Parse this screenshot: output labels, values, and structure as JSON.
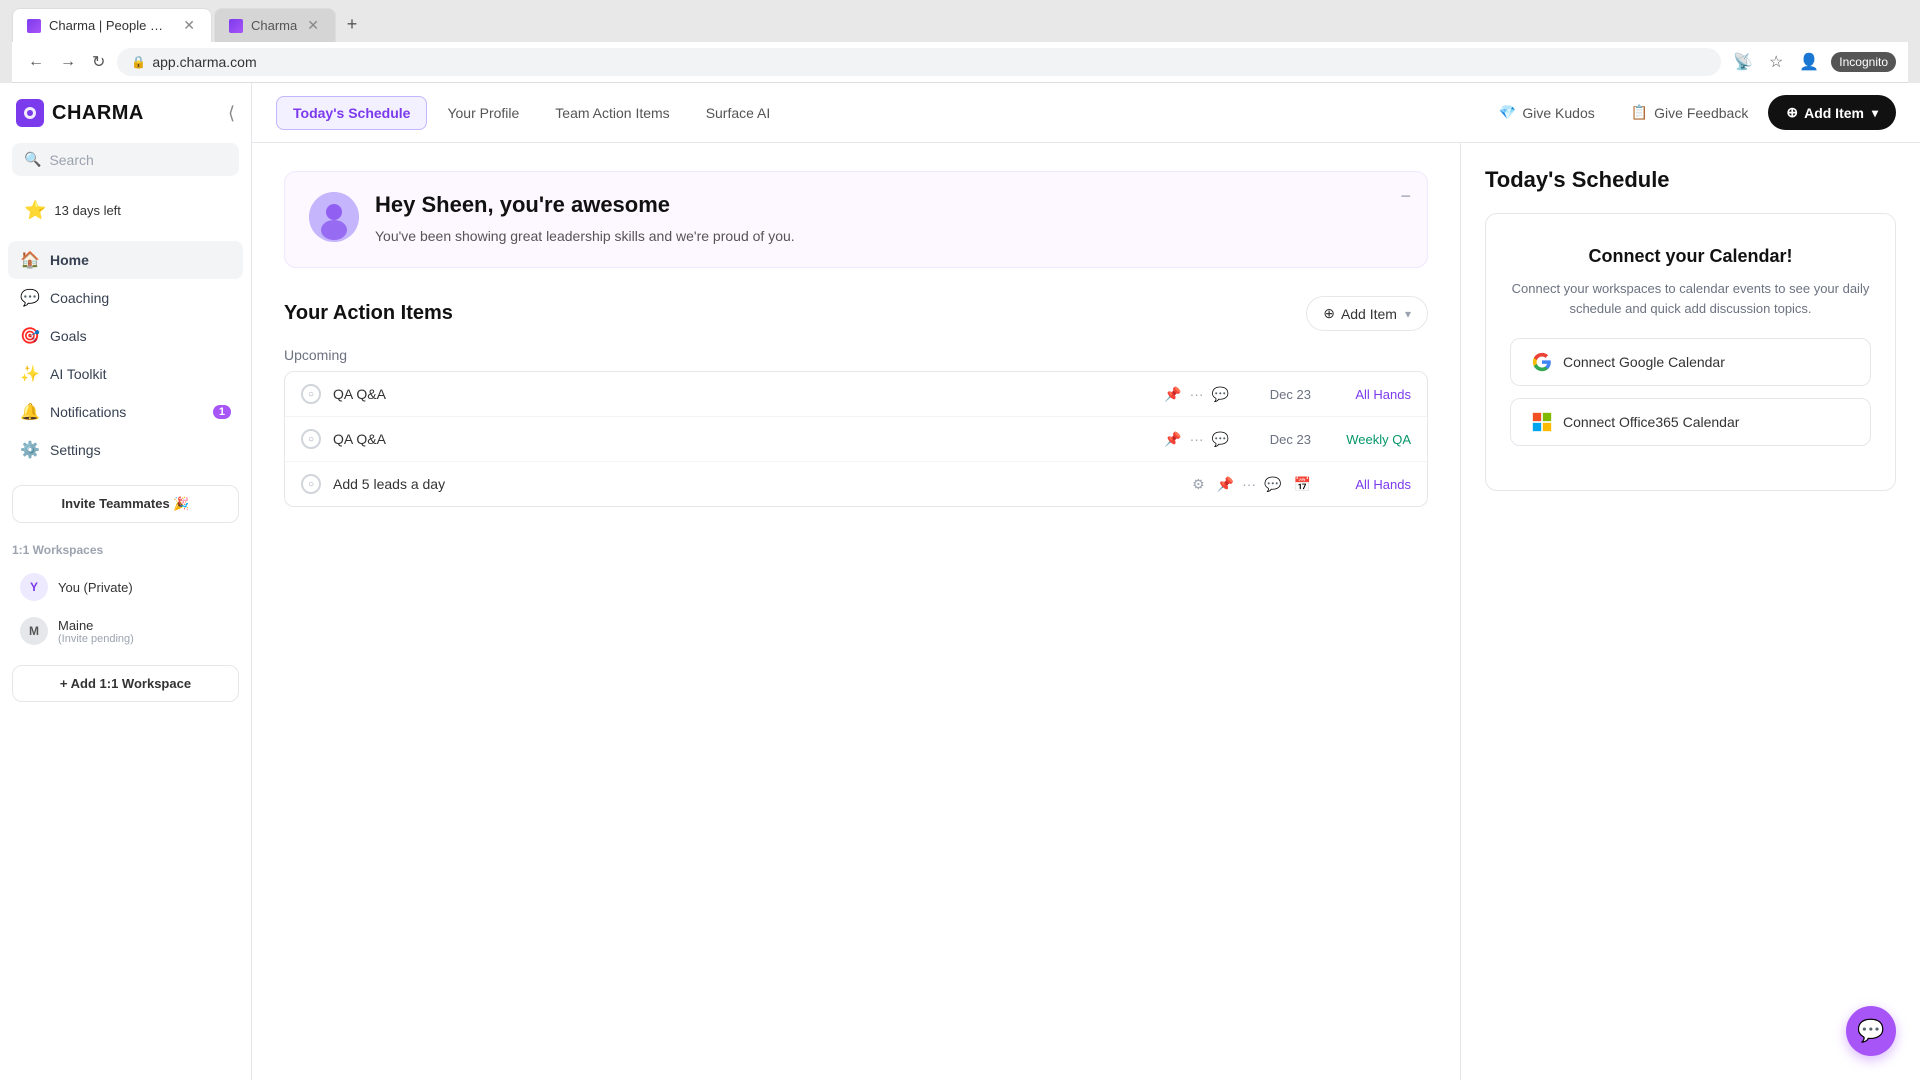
{
  "browser": {
    "tabs": [
      {
        "id": "charma-pm",
        "favicon": "charma",
        "title": "Charma | People Management S...",
        "active": true
      },
      {
        "id": "charma-2",
        "favicon": "charma",
        "title": "Charma",
        "active": false
      }
    ],
    "address": "app.charma.com",
    "incognito_label": "Incognito"
  },
  "sidebar": {
    "logo_text": "CHARMA",
    "search_placeholder": "Search",
    "trial": {
      "icon": "⭐",
      "text": "13 days left"
    },
    "nav_items": [
      {
        "id": "home",
        "icon": "🏠",
        "label": "Home",
        "active": true
      },
      {
        "id": "coaching",
        "icon": "💬",
        "label": "Coaching",
        "active": false
      },
      {
        "id": "goals",
        "icon": "🎯",
        "label": "Goals",
        "active": false
      },
      {
        "id": "ai-toolkit",
        "icon": "✨",
        "label": "AI Toolkit",
        "active": false
      },
      {
        "id": "notifications",
        "icon": "🔔",
        "label": "Notifications",
        "badge": "1",
        "active": false
      },
      {
        "id": "settings",
        "icon": "⚙️",
        "label": "Settings",
        "active": false
      }
    ],
    "invite_btn": "Invite Teammates 🎉",
    "workspaces_label": "1:1 Workspaces",
    "workspaces": [
      {
        "id": "private",
        "name": "You (Private)",
        "sub": "",
        "initial": "Y",
        "color": "purple"
      },
      {
        "id": "maine",
        "name": "Maine",
        "sub": "(Invite pending)",
        "initial": "M",
        "color": "gray"
      }
    ],
    "add_workspace_btn": "+ Add 1:1 Workspace"
  },
  "top_nav": {
    "items": [
      {
        "id": "schedule",
        "label": "Today's Schedule",
        "active": true
      },
      {
        "id": "profile",
        "label": "Your Profile",
        "active": false
      },
      {
        "id": "team-action",
        "label": "Team Action Items",
        "active": false
      },
      {
        "id": "surface-ai",
        "label": "Surface AI",
        "active": false
      }
    ],
    "give_kudos": "Give Kudos",
    "give_feedback": "Give Feedback",
    "add_item": "Add Item"
  },
  "welcome_card": {
    "greeting": "Hey Sheen, you're awesome",
    "description": "You've been showing great leadership skills and we're proud of you."
  },
  "action_items": {
    "section_title": "Your Action Items",
    "add_item_label": "Add Item",
    "upcoming_label": "Upcoming",
    "rows": [
      {
        "id": "qa1",
        "name": "QA Q&A",
        "date": "Dec 23",
        "tag": "All Hands",
        "tag_color": "purple"
      },
      {
        "id": "qa2",
        "name": "QA Q&A",
        "date": "Dec 23",
        "tag": "Weekly QA",
        "tag_color": "purple"
      },
      {
        "id": "leads",
        "name": "Add 5 leads a day",
        "date": "",
        "tag": "All Hands",
        "tag_color": "purple",
        "has_gear": true
      }
    ]
  },
  "right_panel": {
    "title": "Today's Schedule",
    "calendar_card": {
      "title": "Connect your Calendar!",
      "description": "Connect your workspaces to calendar events to see your daily schedule and quick add discussion topics.",
      "google_btn": "Connect Google Calendar",
      "o365_btn": "Connect Office365 Calendar"
    }
  },
  "chat_bubble": {
    "icon": "💬"
  }
}
